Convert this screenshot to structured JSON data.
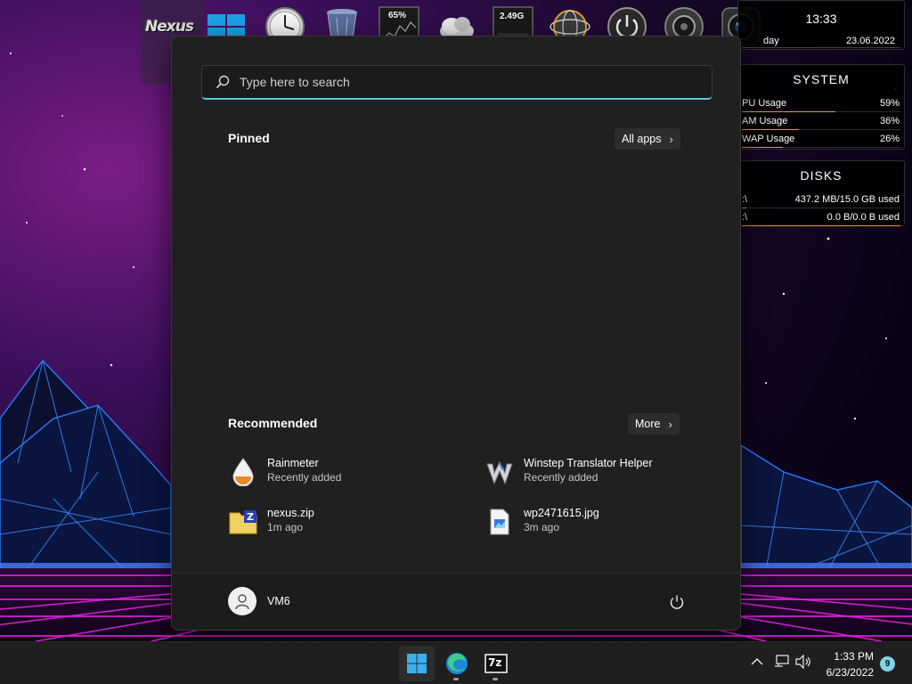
{
  "rainmeter": {
    "clock": {
      "time": "13:33",
      "day": "day",
      "date": "23.06.2022"
    },
    "system": {
      "title": "SYSTEM",
      "rows": [
        {
          "label": "PU Usage",
          "value": "59%",
          "percent": 59
        },
        {
          "label": "AM Usage",
          "value": "36%",
          "percent": 36
        },
        {
          "label": "WAP Usage",
          "value": "26%",
          "percent": 26
        }
      ]
    },
    "disks": {
      "title": "DISKS",
      "rows": [
        {
          "label": ":\\",
          "value": "437.2 MB/15.0 GB used",
          "percent": 3
        },
        {
          "label": ":\\",
          "value": "0.0 B/0.0 B used",
          "percent": 100
        }
      ]
    }
  },
  "dock": {
    "logo": "Nexus",
    "items": [
      {
        "name": "windows-logo-icon"
      },
      {
        "name": "clock-icon"
      },
      {
        "name": "recycle-bin-icon"
      },
      {
        "name": "cpu-meter-icon",
        "label": "65%"
      },
      {
        "name": "weather-icon"
      },
      {
        "name": "memory-meter-icon",
        "label": "2.49G"
      },
      {
        "name": "network-globe-icon"
      },
      {
        "name": "power-orb-icon"
      },
      {
        "name": "speaker-icon"
      },
      {
        "name": "webcam-icon"
      }
    ]
  },
  "start_menu": {
    "search_placeholder": "Type here to search",
    "pinned_title": "Pinned",
    "all_apps_label": "All apps",
    "recommended_title": "Recommended",
    "more_label": "More",
    "recommended": [
      {
        "name": "Rainmeter",
        "sub": "Recently added",
        "icon": "rainmeter-icon"
      },
      {
        "name": "Winstep Translator Helper",
        "sub": "Recently added",
        "icon": "winstep-icon"
      },
      {
        "name": "nexus.zip",
        "sub": "1m ago",
        "icon": "zip-file-icon"
      },
      {
        "name": "wp2471615.jpg",
        "sub": "3m ago",
        "icon": "image-file-icon"
      }
    ],
    "user_name": "VM6"
  },
  "taskbar": {
    "apps": [
      {
        "name": "start-button",
        "icon": "windows-start-icon"
      },
      {
        "name": "edge-button",
        "icon": "edge-icon"
      },
      {
        "name": "7zip-button",
        "icon": "7zip-icon",
        "label": "7z"
      }
    ],
    "clock_time": "1:33 PM",
    "clock_date": "6/23/2022",
    "notification_count": "9"
  },
  "colors": {
    "accent": "#58c9dc",
    "start_bg": "#202020",
    "meter_bar": "#e0a020",
    "neon_magenta": "#e020e0",
    "neon_blue": "#2a6cff"
  }
}
